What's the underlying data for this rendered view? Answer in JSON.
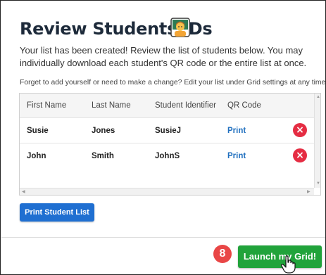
{
  "header": {
    "title": "Review Students IDs"
  },
  "intro_text": "Your list has been created! Review the list of students below. You may individually download each student's QR code or the entire list at once.",
  "note_text": "Forget to add yourself or need to make a change? Edit your list under Grid settings at any time!",
  "table": {
    "columns": [
      "First Name",
      "Last Name",
      "Student Identifier",
      "QR Code"
    ],
    "rows": [
      {
        "first": "Susie",
        "last": "Jones",
        "id": "SusieJ",
        "qr": "Print"
      },
      {
        "first": "John",
        "last": "Smith",
        "id": "JohnS",
        "qr": "Print"
      }
    ],
    "delete_icon": "×"
  },
  "buttons": {
    "print_list": "Print Student List",
    "launch": "Launch my Grid!"
  },
  "step_badge": "8",
  "colors": {
    "primary_blue": "#1f6fd1",
    "launch_green": "#21a33b",
    "delete_red": "#e52d43",
    "badge_red": "#e94646"
  },
  "icons": {
    "title_icon": "student-emoji-icon",
    "delete": "remove-circle-icon",
    "cursor": "hand-pointer-icon"
  }
}
